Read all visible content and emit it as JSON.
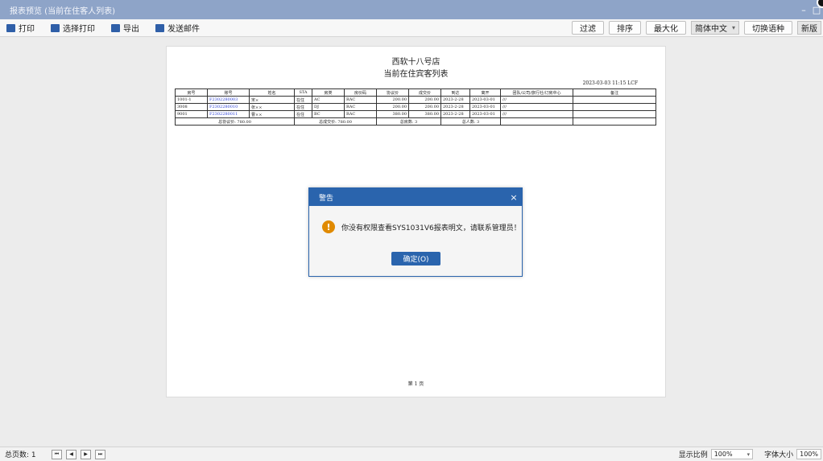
{
  "window": {
    "title": "报表预览 (当前在住客人列表)",
    "minimize": "–",
    "maximize": "□"
  },
  "toolbar": {
    "print": "打印",
    "select_print": "选择打印",
    "export": "导出",
    "send_mail": "发送邮件",
    "filter": "过滤",
    "sort": "排序",
    "maximize": "最大化",
    "language_value": "简体中文",
    "switch_language": "切换语种",
    "font_value": "新版"
  },
  "report": {
    "title": "西软十八号店",
    "subtitle": "当前在住宾客列表",
    "date_line": "2023-03-03 11:15 LCF",
    "columns": [
      "房号",
      "账号",
      "姓名",
      "STA",
      "房类",
      "房价码",
      "协议价",
      "成交价",
      "到达",
      "离开",
      "团队/公司/旅行社/订房中心",
      "备注"
    ],
    "rows": [
      [
        "1001-1",
        "F2302280003",
        "宋×",
        "在住",
        "AC",
        "RAC",
        "200.00",
        "200.00",
        "2023-2-28",
        "2023-03-01",
        "///",
        ""
      ],
      [
        "3008",
        "F2302280010",
        "张××",
        "在住",
        "DJ",
        "RAC",
        "200.00",
        "200.00",
        "2023-2-28",
        "2023-03-01",
        "///",
        ""
      ],
      [
        "9001",
        "F2302280011",
        "曹××",
        "在住",
        "BC",
        "RAC",
        "380.00",
        "380.00",
        "2023-2-28",
        "2023-03-01",
        "///",
        ""
      ]
    ],
    "totals": {
      "agreed": "总协议价: 780.00",
      "deal": "总成交价: 780.00",
      "rooms": "总房数: 3",
      "guests": "总人数: 3"
    },
    "page_label": "第 1 页"
  },
  "dialog": {
    "title": "警告",
    "close": "×",
    "icon": "warning-icon",
    "message": "你没有权限查看SYS1031V6报表明文，请联系管理员！",
    "ok": "确定(O)"
  },
  "status": {
    "total_pages": "总页数: 1",
    "nav_first": "⏮",
    "nav_prev": "◀",
    "nav_next": "▶",
    "nav_last": "⏭",
    "zoom_label": "显示比例",
    "zoom_value": "100%",
    "font_size_label": "字体大小",
    "font_size_value": "100%"
  },
  "colors": {
    "titlebar": "#8ea4c8",
    "dialog_accent": "#2a64ad",
    "warning": "#e08a00",
    "link": "#2b3fd6"
  }
}
